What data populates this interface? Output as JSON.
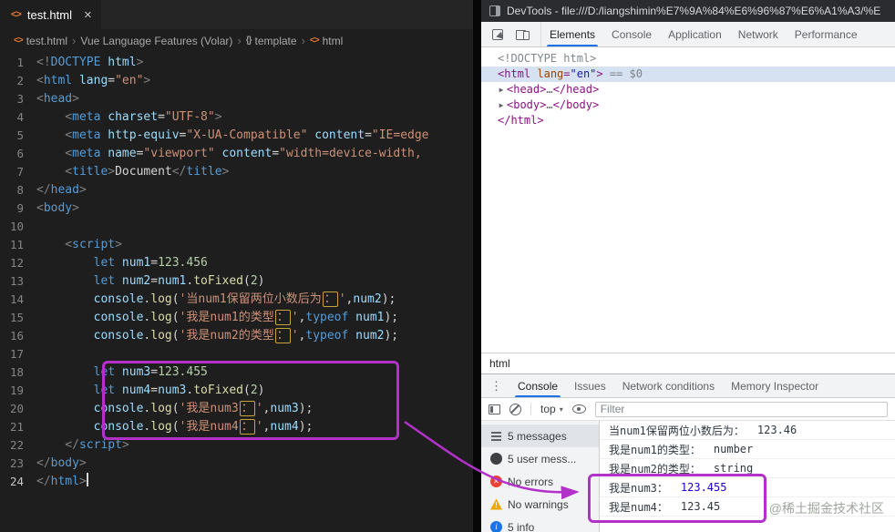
{
  "annotation_color": "#b231c9",
  "editor": {
    "tab": {
      "icon_glyph": "<>",
      "title": "test.html",
      "close_glyph": "×"
    },
    "breadcrumb": [
      {
        "icon": "html-file-icon",
        "glyph": "<>",
        "label": "test.html"
      },
      {
        "icon": "",
        "glyph": "",
        "label": "Vue Language Features (Volar)"
      },
      {
        "icon": "braces-icon",
        "glyph": "{}",
        "label": "template"
      },
      {
        "icon": "html-tag-icon",
        "glyph": "<>",
        "label": "html"
      }
    ],
    "lines": [
      {
        "n": "1",
        "seg": [
          [
            "p",
            "<!"
          ],
          [
            "kw",
            "DOCTYPE"
          ],
          [
            "attr",
            " html"
          ],
          [
            "p",
            ">"
          ]
        ]
      },
      {
        "n": "2",
        "seg": [
          [
            "p",
            "<"
          ],
          [
            "tag",
            "html"
          ],
          [
            "attr",
            " lang"
          ],
          [
            "op",
            "="
          ],
          [
            "str",
            "\"en\""
          ],
          [
            "p",
            ">"
          ]
        ]
      },
      {
        "n": "3",
        "seg": [
          [
            "p",
            "<"
          ],
          [
            "tag",
            "head"
          ],
          [
            "p",
            ">"
          ]
        ]
      },
      {
        "n": "4",
        "seg": [
          [
            "p",
            "    <"
          ],
          [
            "tag",
            "meta"
          ],
          [
            "attr",
            " charset"
          ],
          [
            "op",
            "="
          ],
          [
            "str",
            "\"UTF-8\""
          ],
          [
            "p",
            ">"
          ]
        ]
      },
      {
        "n": "5",
        "seg": [
          [
            "p",
            "    <"
          ],
          [
            "tag",
            "meta"
          ],
          [
            "attr",
            " http-equiv"
          ],
          [
            "op",
            "="
          ],
          [
            "str",
            "\"X-UA-Compatible\""
          ],
          [
            "attr",
            " content"
          ],
          [
            "op",
            "="
          ],
          [
            "str",
            "\"IE=edge"
          ]
        ]
      },
      {
        "n": "6",
        "seg": [
          [
            "p",
            "    <"
          ],
          [
            "tag",
            "meta"
          ],
          [
            "attr",
            " name"
          ],
          [
            "op",
            "="
          ],
          [
            "str",
            "\"viewport\""
          ],
          [
            "attr",
            " content"
          ],
          [
            "op",
            "="
          ],
          [
            "str",
            "\"width=device-width,"
          ]
        ]
      },
      {
        "n": "7",
        "seg": [
          [
            "p",
            "    <"
          ],
          [
            "tag",
            "title"
          ],
          [
            "p",
            ">"
          ],
          [
            "txt",
            "Document"
          ],
          [
            "p",
            "</"
          ],
          [
            "tag",
            "title"
          ],
          [
            "p",
            ">"
          ]
        ]
      },
      {
        "n": "8",
        "seg": [
          [
            "p",
            "</"
          ],
          [
            "tag",
            "head"
          ],
          [
            "p",
            ">"
          ]
        ]
      },
      {
        "n": "9",
        "seg": [
          [
            "p",
            "<"
          ],
          [
            "tag",
            "body"
          ],
          [
            "p",
            ">"
          ]
        ]
      },
      {
        "n": "10",
        "seg": []
      },
      {
        "n": "11",
        "seg": [
          [
            "p",
            "    <"
          ],
          [
            "tag",
            "script"
          ],
          [
            "p",
            ">"
          ]
        ]
      },
      {
        "n": "12",
        "seg": [
          [
            "txt",
            "        "
          ],
          [
            "kw",
            "let"
          ],
          [
            "var",
            " num1"
          ],
          [
            "op",
            "="
          ],
          [
            "num",
            "123.456"
          ]
        ]
      },
      {
        "n": "13",
        "seg": [
          [
            "txt",
            "        "
          ],
          [
            "kw",
            "let"
          ],
          [
            "var",
            " num2"
          ],
          [
            "op",
            "="
          ],
          [
            "var",
            "num1"
          ],
          [
            "op",
            "."
          ],
          [
            "fn",
            "toFixed"
          ],
          [
            "op",
            "("
          ],
          [
            "num",
            "2"
          ],
          [
            "op",
            ")"
          ]
        ]
      },
      {
        "n": "14",
        "seg": [
          [
            "txt",
            "        "
          ],
          [
            "var",
            "console"
          ],
          [
            "op",
            "."
          ],
          [
            "fn",
            "log"
          ],
          [
            "op",
            "("
          ],
          [
            "str",
            "'当num1保留两位小数后为"
          ],
          [
            "strbox",
            "："
          ],
          [
            "str",
            "'"
          ],
          [
            "op",
            ","
          ],
          [
            "var",
            "num2"
          ],
          [
            "op",
            ");"
          ]
        ]
      },
      {
        "n": "15",
        "seg": [
          [
            "txt",
            "        "
          ],
          [
            "var",
            "console"
          ],
          [
            "op",
            "."
          ],
          [
            "fn",
            "log"
          ],
          [
            "op",
            "("
          ],
          [
            "str",
            "'我是num1的类型"
          ],
          [
            "strbox",
            "："
          ],
          [
            "str",
            "'"
          ],
          [
            "op",
            ","
          ],
          [
            "kw",
            "typeof"
          ],
          [
            "var",
            " num1"
          ],
          [
            "op",
            ");"
          ]
        ]
      },
      {
        "n": "16",
        "seg": [
          [
            "txt",
            "        "
          ],
          [
            "var",
            "console"
          ],
          [
            "op",
            "."
          ],
          [
            "fn",
            "log"
          ],
          [
            "op",
            "("
          ],
          [
            "str",
            "'我是num2的类型"
          ],
          [
            "strbox",
            "："
          ],
          [
            "str",
            "'"
          ],
          [
            "op",
            ","
          ],
          [
            "kw",
            "typeof"
          ],
          [
            "var",
            " num2"
          ],
          [
            "op",
            ");"
          ]
        ]
      },
      {
        "n": "17",
        "seg": []
      },
      {
        "n": "18",
        "seg": [
          [
            "txt",
            "        "
          ],
          [
            "kw",
            "let"
          ],
          [
            "var",
            " num3"
          ],
          [
            "op",
            "="
          ],
          [
            "num",
            "123.455"
          ]
        ]
      },
      {
        "n": "19",
        "seg": [
          [
            "txt",
            "        "
          ],
          [
            "kw",
            "let"
          ],
          [
            "var",
            " num4"
          ],
          [
            "op",
            "="
          ],
          [
            "var",
            "num3"
          ],
          [
            "op",
            "."
          ],
          [
            "fn",
            "toFixed"
          ],
          [
            "op",
            "("
          ],
          [
            "num",
            "2"
          ],
          [
            "op",
            ")"
          ]
        ]
      },
      {
        "n": "20",
        "seg": [
          [
            "txt",
            "        "
          ],
          [
            "var",
            "console"
          ],
          [
            "op",
            "."
          ],
          [
            "fn",
            "log"
          ],
          [
            "op",
            "("
          ],
          [
            "str",
            "'我是num3"
          ],
          [
            "strbox",
            "："
          ],
          [
            "str",
            "'"
          ],
          [
            "op",
            ","
          ],
          [
            "var",
            "num3"
          ],
          [
            "op",
            ");"
          ]
        ]
      },
      {
        "n": "21",
        "seg": [
          [
            "txt",
            "        "
          ],
          [
            "var",
            "console"
          ],
          [
            "op",
            "."
          ],
          [
            "fn",
            "log"
          ],
          [
            "op",
            "("
          ],
          [
            "str",
            "'我是num4"
          ],
          [
            "strbox",
            "："
          ],
          [
            "str",
            "'"
          ],
          [
            "op",
            ","
          ],
          [
            "var",
            "num4"
          ],
          [
            "op",
            ");"
          ]
        ]
      },
      {
        "n": "22",
        "seg": [
          [
            "p",
            "    </"
          ],
          [
            "tag",
            "script"
          ],
          [
            "p",
            ">"
          ]
        ]
      },
      {
        "n": "23",
        "seg": [
          [
            "p",
            "</"
          ],
          [
            "tag",
            "body"
          ],
          [
            "p",
            ">"
          ]
        ]
      },
      {
        "n": "24",
        "cursor": true,
        "seg": [
          [
            "p",
            "</"
          ],
          [
            "tag",
            "html"
          ],
          [
            "p",
            ">"
          ]
        ]
      }
    ]
  },
  "devtools": {
    "window_title": "DevTools - file:///D:/liangshimin%E7%9A%84%E6%96%87%E6%A1%A3/%E",
    "panel_tabs": [
      {
        "label": "Elements",
        "active": true
      },
      {
        "label": "Console",
        "active": false
      },
      {
        "label": "Application",
        "active": false
      },
      {
        "label": "Network",
        "active": false
      },
      {
        "label": "Performance",
        "active": false
      }
    ],
    "elements_rows": [
      {
        "arrow": false,
        "selected": false,
        "indent": 0,
        "seg": [
          [
            "edoc",
            "<!DOCTYPE html>"
          ]
        ]
      },
      {
        "arrow": false,
        "selected": true,
        "indent": 0,
        "seg": [
          [
            "ep",
            "<"
          ],
          [
            "etag",
            "html"
          ],
          [
            "eattr",
            " lang"
          ],
          [
            "ep",
            "="
          ],
          [
            "eval",
            "\"en\""
          ],
          [
            "ep",
            ">"
          ],
          [
            "emeta",
            " == $0"
          ]
        ]
      },
      {
        "arrow": true,
        "selected": false,
        "indent": 1,
        "seg": [
          [
            "ep",
            "<"
          ],
          [
            "etag",
            "head"
          ],
          [
            "ep",
            ">"
          ],
          [
            "edots",
            "…"
          ],
          [
            "ep",
            "</"
          ],
          [
            "etag",
            "head"
          ],
          [
            "ep",
            ">"
          ]
        ]
      },
      {
        "arrow": true,
        "selected": false,
        "indent": 1,
        "seg": [
          [
            "ep",
            "<"
          ],
          [
            "etag",
            "body"
          ],
          [
            "ep",
            ">"
          ],
          [
            "edots",
            "…"
          ],
          [
            "ep",
            "</"
          ],
          [
            "etag",
            "body"
          ],
          [
            "ep",
            ">"
          ]
        ]
      },
      {
        "arrow": false,
        "selected": false,
        "indent": 0,
        "seg": [
          [
            "ep",
            "</"
          ],
          [
            "etag",
            "html"
          ],
          [
            "ep",
            ">"
          ]
        ]
      }
    ],
    "elements_breadcrumb": "html",
    "drawer": {
      "tabs": [
        {
          "label": "Console",
          "active": true
        },
        {
          "label": "Issues",
          "active": false
        },
        {
          "label": "Network conditions",
          "active": false
        },
        {
          "label": "Memory Inspector",
          "active": false
        }
      ],
      "context_selector": "top",
      "filter_placeholder": "Filter",
      "sidebar": [
        {
          "icon": "messages-icon",
          "label": "5 messages",
          "selected": true
        },
        {
          "icon": "user-messages-icon",
          "label": "5 user mess...",
          "selected": false
        },
        {
          "icon": "error-icon",
          "label": "No errors",
          "selected": false
        },
        {
          "icon": "warning-icon",
          "label": "No warnings",
          "selected": false
        },
        {
          "icon": "info-icon",
          "label": "5 info",
          "selected": false
        }
      ],
      "messages": [
        {
          "label": "当num1保留两位小数后为：",
          "value": "123.46",
          "kind": "string"
        },
        {
          "label": "我是num1的类型：",
          "value": "number",
          "kind": "string"
        },
        {
          "label": "我是num2的类型：",
          "value": "string",
          "kind": "string"
        },
        {
          "label": "我是num3：",
          "value": "123.455",
          "kind": "number"
        },
        {
          "label": "我是num4：",
          "value": "123.45",
          "kind": "string"
        }
      ]
    },
    "watermark": "@稀土掘金技术社区"
  }
}
